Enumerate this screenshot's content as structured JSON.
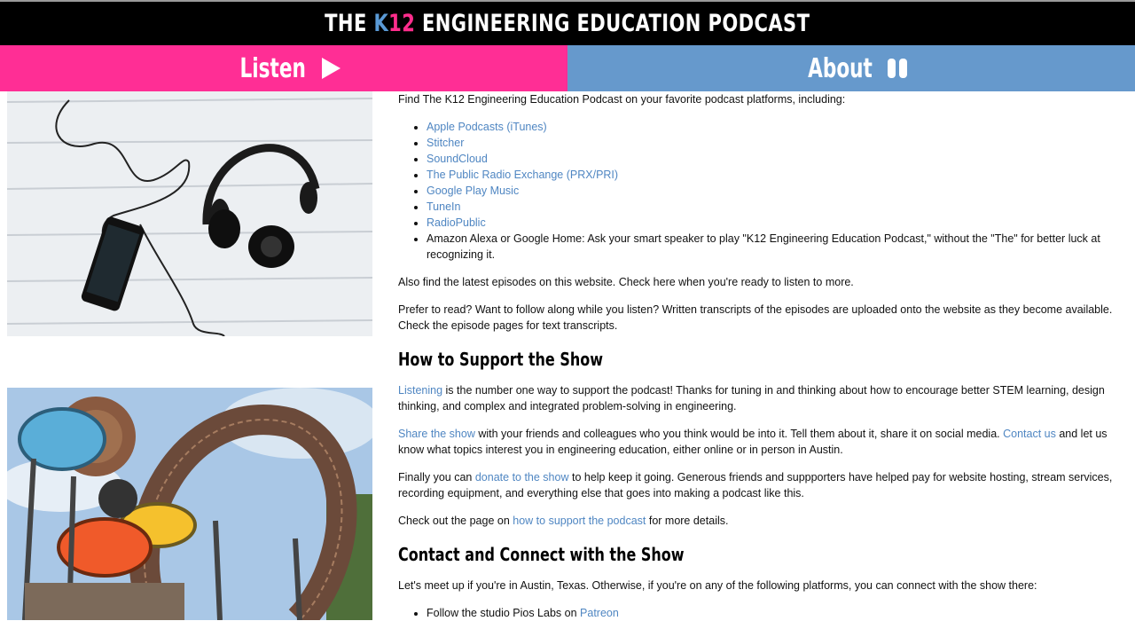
{
  "header": {
    "title_pre": "THE ",
    "title_k": "K",
    "title_12": "12",
    "title_post": " ENGINEERING EDUCATION PODCAST"
  },
  "nav": {
    "listen_label": "Listen",
    "listen_icon": "play-icon",
    "about_label": "About",
    "about_icon": "pause-icon",
    "listen_color": "#ff2e95",
    "about_color": "#6699cc"
  },
  "images": {
    "image1": "headphones-and-phone-photo",
    "image2": "playground-structure-photo"
  },
  "main": {
    "intro": "Find The K12 Engineering Education Podcast on your favorite podcast platforms, including:",
    "platforms": [
      "Apple Podcasts (iTunes)",
      "Stitcher",
      "SoundCloud",
      "The Public Radio Exchange (PRX/PRI)",
      "Google Play Music",
      "TuneIn",
      "RadioPublic"
    ],
    "alexa": "Amazon Alexa or Google Home: Ask your smart speaker to play \"K12 Engineering Education Podcast,\" without the \"The\" for better luck at recognizing it.",
    "also": "Also find the latest episodes on this website. Check here when you're ready to listen to more.",
    "prefer": "Prefer to read? Want to follow along while you listen? Written transcripts of the episodes are uploaded onto the website as they become available. Check the episode pages for text transcripts.",
    "support_heading": "How to Support the Show",
    "support1_link": "Listening",
    "support1_text": " is the number one way to support the podcast! Thanks for tuning in and thinking about how to encourage better STEM learning, design thinking, and complex and integrated problem-solving in engineering.",
    "support2_link": "Share the show",
    "support2_text": " with your friends and colleagues who you think would be into it. Tell them about it, share it on social media. ",
    "support2_link2": "Contact us",
    "support2_text2": " and let us know what topics interest you in engineering education, either online or in person in Austin.",
    "support3_pre": "Finally you can ",
    "support3_link": "donate to the show",
    "support3_text": " to help keep it going. Generous friends and suppporters have helped pay for website hosting, stream services, recording equipment, and everything else that goes into making a podcast like this.",
    "support4_pre": "Check out the page on ",
    "support4_link": "how to support the podcast",
    "support4_text": " for more details.",
    "contact_heading": "Contact and Connect with the Show",
    "contact_intro": "Let's meet up if you're in Austin, Texas. Otherwise, if you're on any of the following platforms, you can connect with the show there:",
    "contact_item1_pre": "Follow the studio Pios Labs on ",
    "contact_item1_link": "Patreon"
  }
}
